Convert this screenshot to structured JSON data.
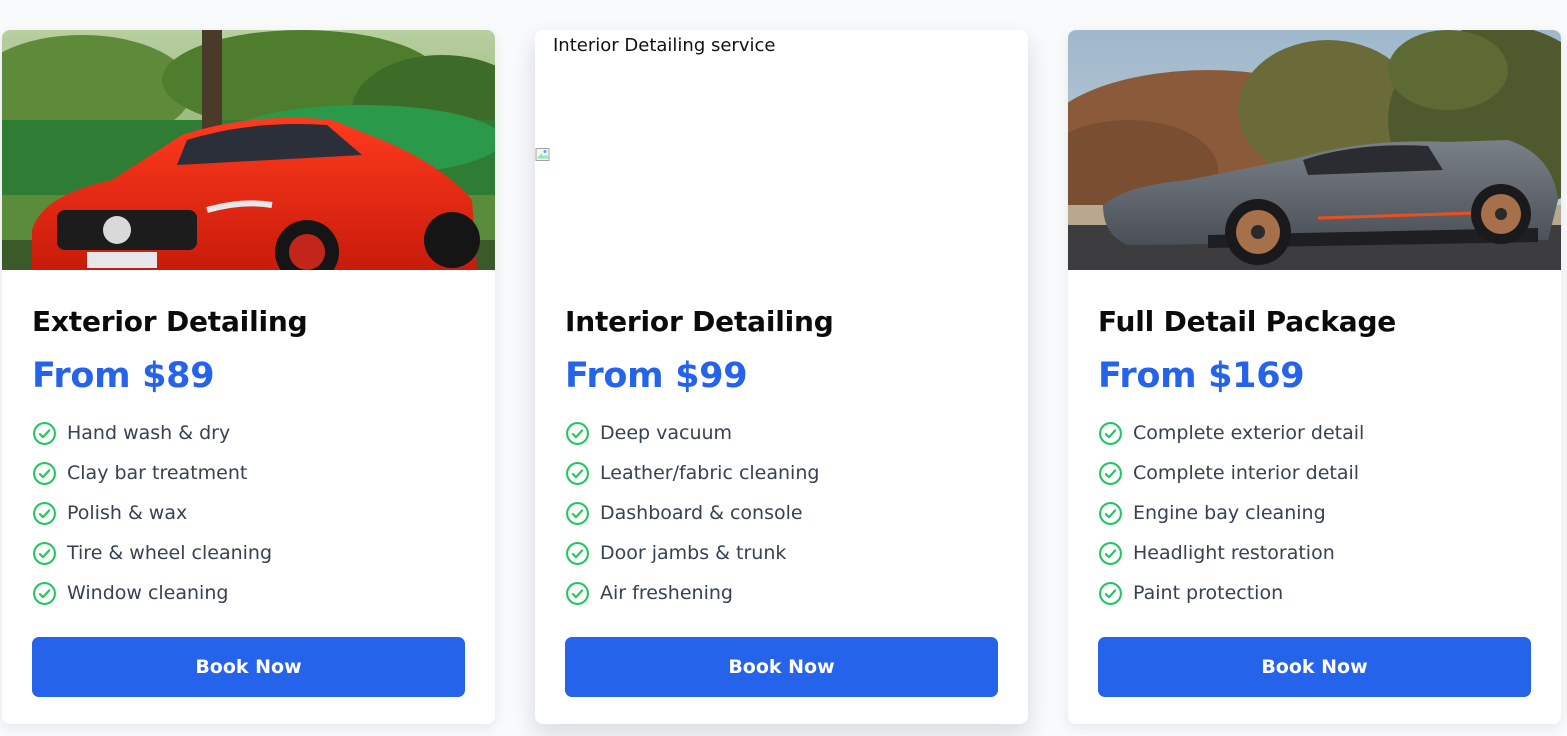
{
  "colors": {
    "accent": "#2563eb",
    "check": "#22c55e",
    "text": "#374151",
    "heading": "#0b0b0b",
    "background": "#f8fafc",
    "card": "#ffffff"
  },
  "cards": [
    {
      "image_alt": "",
      "image_subject": "red sports coupe in park",
      "title": "Exterior Detailing",
      "price": "From $89",
      "features": [
        "Hand wash & dry",
        "Clay bar treatment",
        "Polish & wax",
        "Tire & wheel cleaning",
        "Window cleaning"
      ],
      "button": "Book Now"
    },
    {
      "image_alt": "Interior Detailing service",
      "image_subject": "broken image placeholder",
      "title": "Interior Detailing",
      "price": "From $99",
      "features": [
        "Deep vacuum",
        "Leather/fabric cleaning",
        "Dashboard & console",
        "Door jambs & trunk",
        "Air freshening"
      ],
      "button": "Book Now"
    },
    {
      "image_alt": "",
      "image_subject": "gray convertible supercar by hedge",
      "title": "Full Detail Package",
      "price": "From $169",
      "features": [
        "Complete exterior detail",
        "Complete interior detail",
        "Engine bay cleaning",
        "Headlight restoration",
        "Paint protection"
      ],
      "button": "Book Now"
    }
  ]
}
